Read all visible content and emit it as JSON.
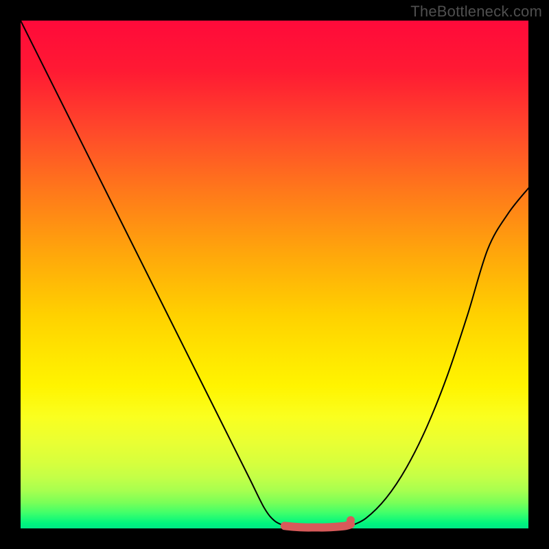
{
  "watermark": "TheBottleneck.com",
  "chart_data": {
    "type": "line",
    "title": "",
    "xlabel": "",
    "ylabel": "",
    "xlim": [
      0,
      100
    ],
    "ylim": [
      0,
      100
    ],
    "grid": false,
    "legend": false,
    "series": [
      {
        "name": "left-curve",
        "color": "#000000",
        "x": [
          0,
          5,
          10,
          15,
          20,
          25,
          30,
          35,
          40,
          45,
          48,
          50,
          52
        ],
        "y": [
          100,
          90,
          80,
          70,
          60,
          50,
          40,
          30,
          20,
          10,
          4,
          1.5,
          0.5
        ]
      },
      {
        "name": "right-curve",
        "color": "#000000",
        "x": [
          65,
          68,
          72,
          76,
          80,
          84,
          88,
          92,
          96,
          100
        ],
        "y": [
          0.5,
          2,
          6,
          12,
          20,
          30,
          42,
          55,
          62,
          67
        ]
      },
      {
        "name": "bottom-marker-band",
        "color": "#d75a5a",
        "x": [
          52,
          54,
          56,
          58,
          60,
          62,
          64,
          65
        ],
        "y": [
          0.5,
          0.3,
          0.2,
          0.2,
          0.2,
          0.3,
          0.5,
          0.8
        ]
      }
    ],
    "annotations": []
  },
  "colors": {
    "curve": "#000000",
    "marker": "#d75a5a",
    "frame": "#000000"
  }
}
